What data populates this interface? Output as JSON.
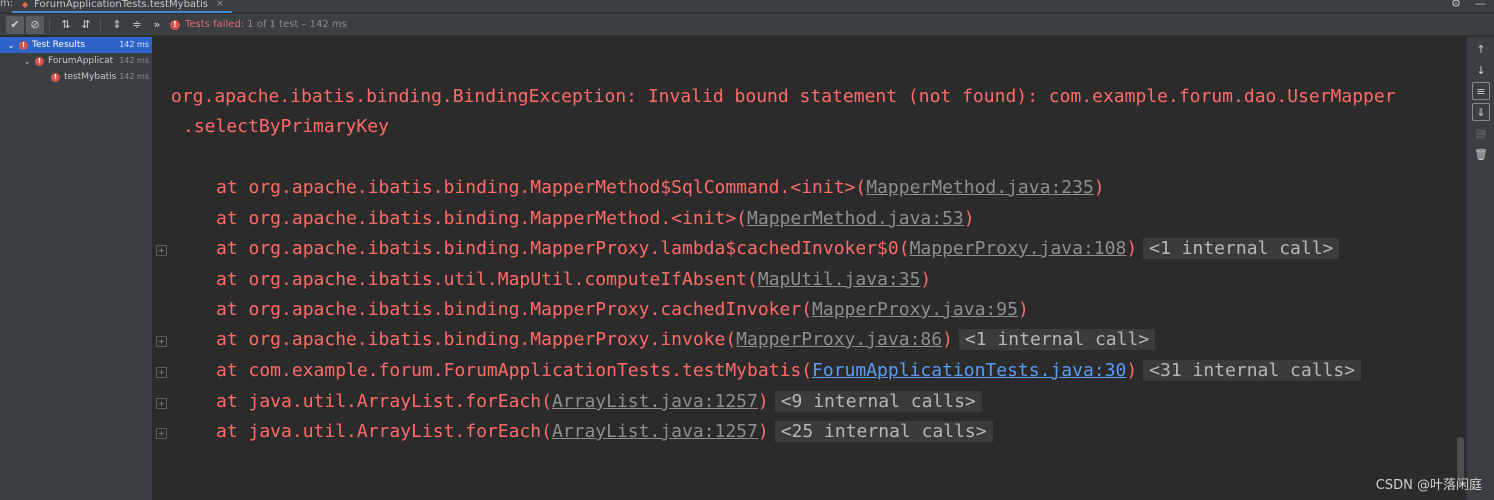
{
  "tabbar": {
    "prefix": "m:",
    "tab_title": "ForumApplicationTests.testMybatis",
    "close_glyph": "×",
    "gear_glyph": "⚙",
    "minimize_glyph": "—"
  },
  "toolbar": {
    "status_failed": "Tests failed:",
    "status_rest": "1 of 1 test – 142 ms",
    "more_glyph": "»"
  },
  "tree": {
    "root": {
      "label": "Test Results",
      "time": "142 ms"
    },
    "class": {
      "label": "ForumApplicat",
      "time": "142 ms"
    },
    "method": {
      "label": "testMybatis",
      "time": "142 ms"
    }
  },
  "console": {
    "exception_line1": "org.apache.ibatis.binding.BindingException: Invalid bound statement (not found): com.example.forum.dao.UserMapper",
    "exception_line2": ".selectByPrimaryKey",
    "frames": [
      {
        "text": "at org.apache.ibatis.binding.MapperMethod$SqlCommand.<init>(",
        "link": "MapperMethod.java:235",
        "close": ")",
        "internal": ""
      },
      {
        "text": "at org.apache.ibatis.binding.MapperMethod.<init>(",
        "link": "MapperMethod.java:53",
        "close": ")",
        "internal": ""
      },
      {
        "text": "at org.apache.ibatis.binding.MapperProxy.lambda$cachedInvoker$0(",
        "link": "MapperProxy.java:108",
        "close": ")",
        "internal": "<1 internal call>"
      },
      {
        "text": "at org.apache.ibatis.util.MapUtil.computeIfAbsent(",
        "link": "MapUtil.java:35",
        "close": ")",
        "internal": ""
      },
      {
        "text": "at org.apache.ibatis.binding.MapperProxy.cachedInvoker(",
        "link": "MapperProxy.java:95",
        "close": ")",
        "internal": ""
      },
      {
        "text": "at org.apache.ibatis.binding.MapperProxy.invoke(",
        "link": "MapperProxy.java:86",
        "close": ")",
        "internal": "<1 internal call>"
      },
      {
        "text": "at com.example.forum.ForumApplicationTests.testMybatis(",
        "link": "ForumApplicationTests.java:30",
        "close": ")",
        "internal": "<31 internal calls>"
      },
      {
        "text": "at java.util.ArrayList.forEach(",
        "link": "ArrayList.java:1257",
        "close": ")",
        "internal": "<9 internal calls>"
      },
      {
        "text": "at java.util.ArrayList.forEach(",
        "link": "ArrayList.java:1257",
        "close": ")",
        "internal": "<25 internal calls>"
      }
    ]
  },
  "watermark": "CSDN @叶落闲庭",
  "colors": {
    "error_red": "#ff6b68",
    "link_blue": "#589df6",
    "selection_blue": "#2f65ca"
  }
}
